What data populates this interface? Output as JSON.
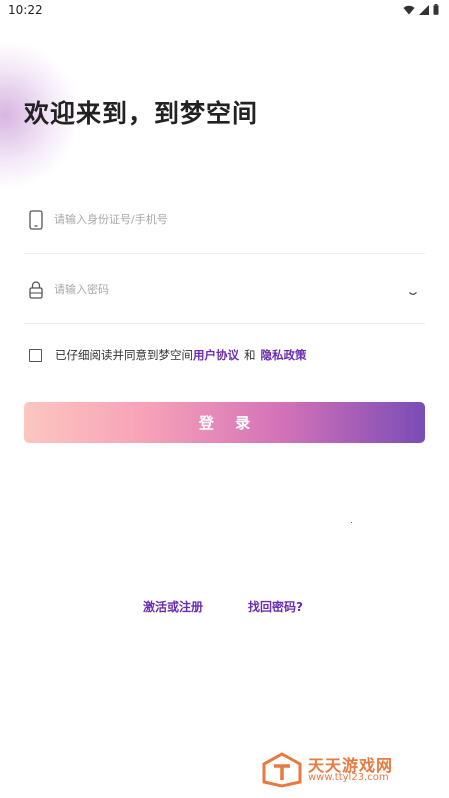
{
  "status_bar": {
    "time": "10:22",
    "icons": [
      "wifi-icon",
      "signal-icon",
      "battery-icon"
    ]
  },
  "welcome_title": "欢迎来到，到梦空间",
  "login_form": {
    "id_placeholder": "请输入身份证号/手机号",
    "password_placeholder": "请输入密码",
    "agreement_prefix": "已仔细阅读并同意到梦空间",
    "user_agreement_link": "用户协议",
    "and_text": "和",
    "privacy_policy_link": "隐私政策",
    "login_button": "登 录"
  },
  "footer_links": {
    "register": "激活或注册",
    "forgot_password": "找回密码?"
  },
  "watermark": {
    "title": "天天游戏网",
    "url": "www.ttyl23.com"
  },
  "colors": {
    "link": "#6b2db0",
    "button_gradient": [
      "#fcc6c0",
      "#f7a2b8",
      "#d271b8",
      "#7a4cb6"
    ],
    "watermark": "#e8793f"
  }
}
